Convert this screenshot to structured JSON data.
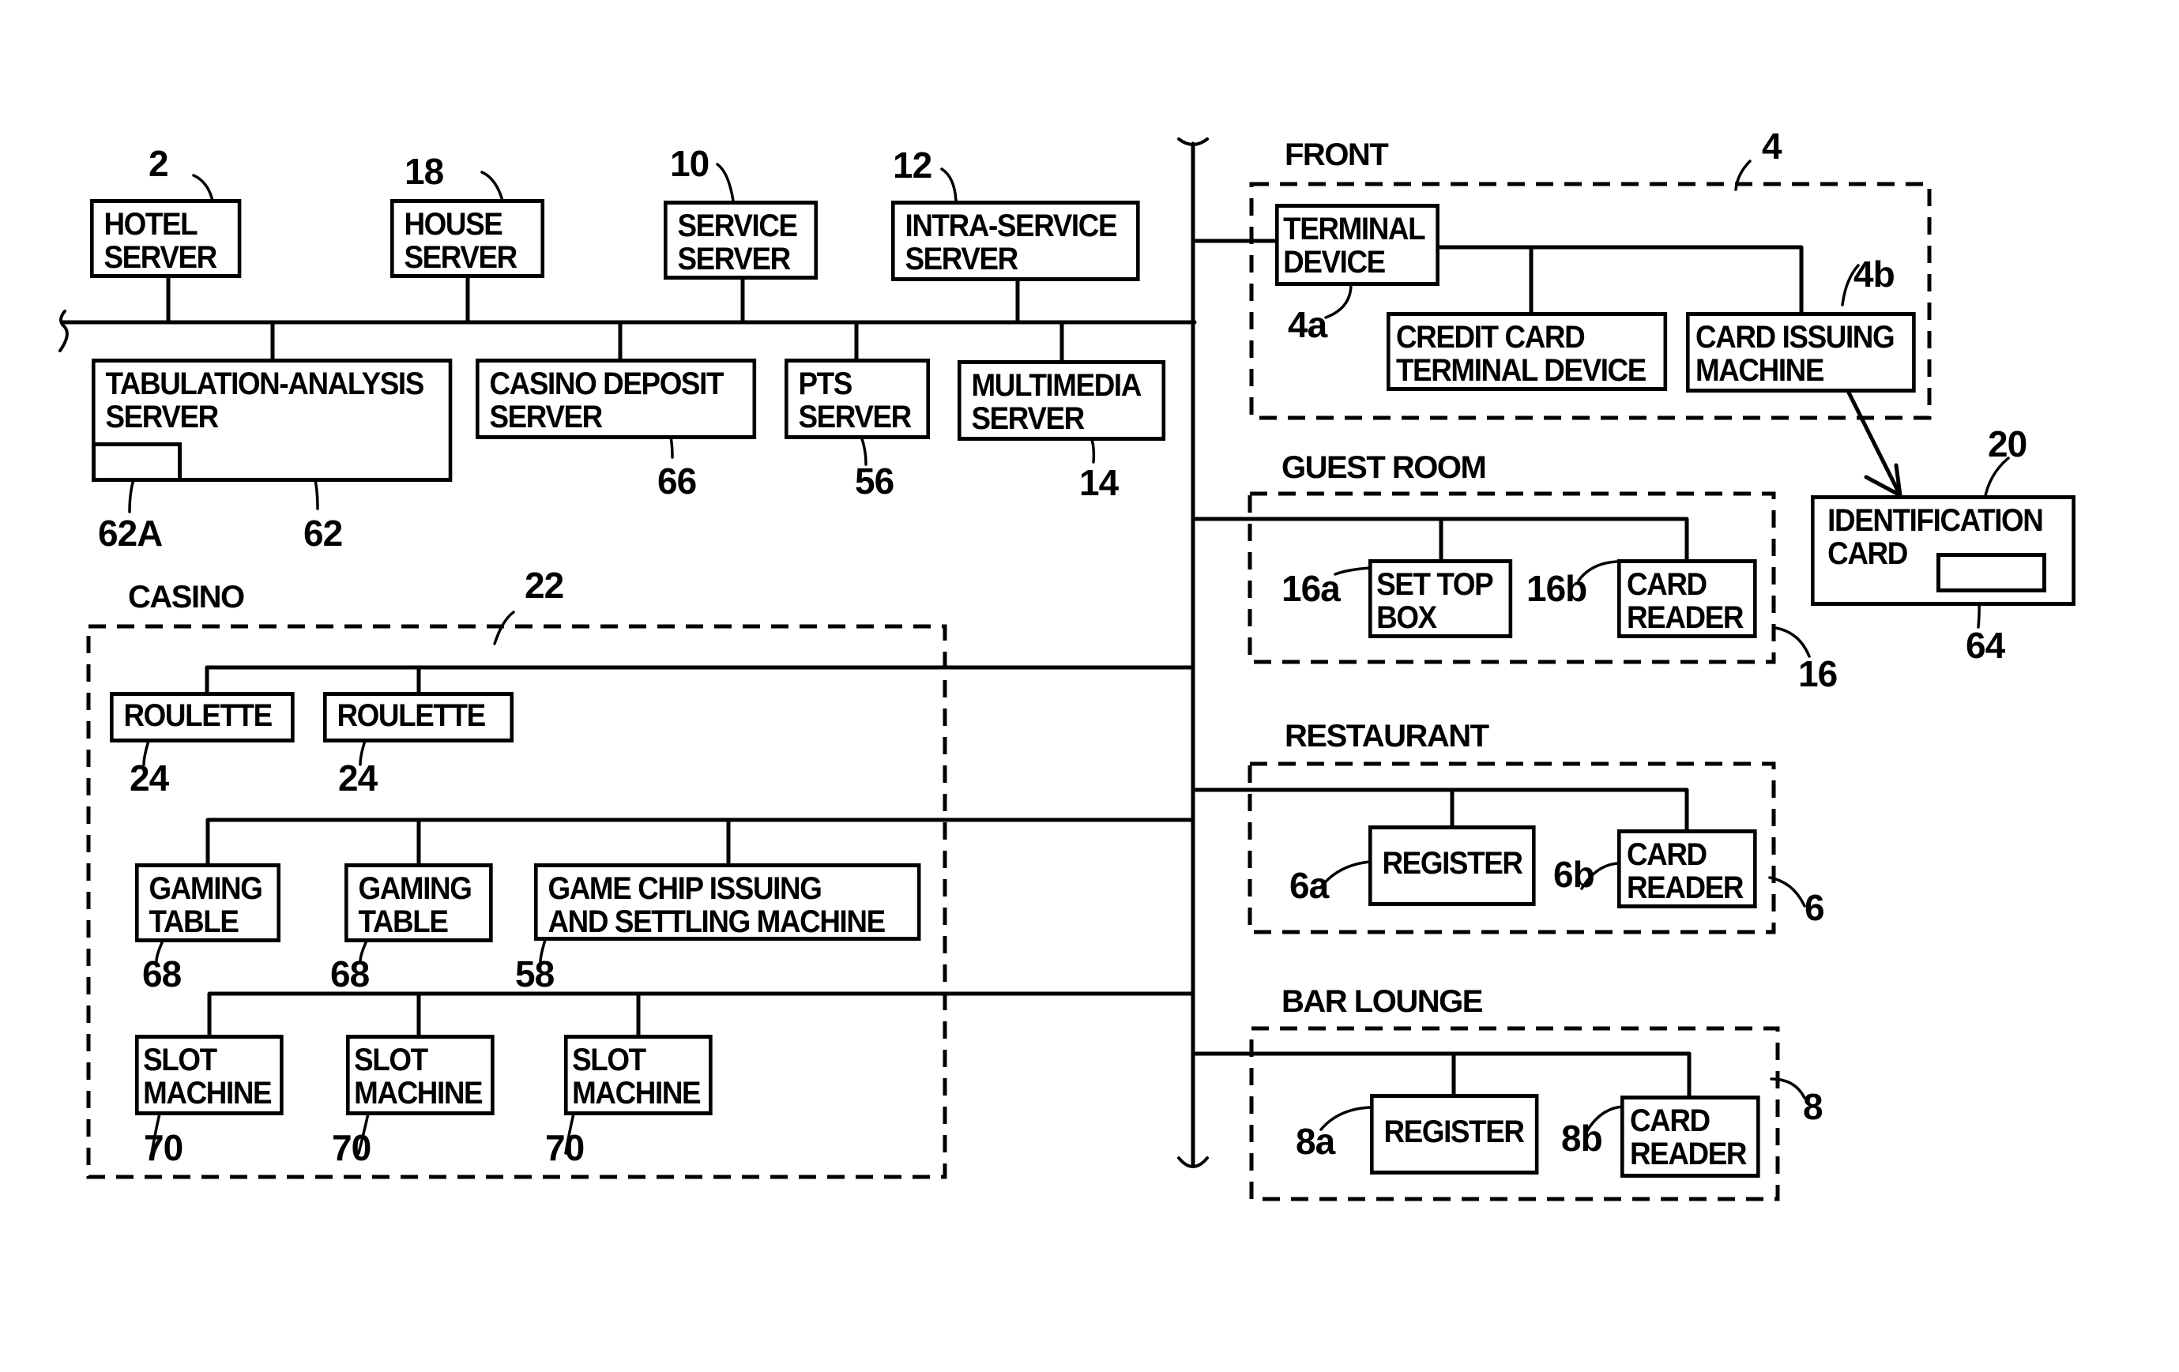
{
  "figure": {
    "bus": {
      "top_network": "hotel-lan",
      "trunk": "vertical-trunk"
    },
    "servers": [
      {
        "id": "hotel-server",
        "label_lines": [
          "HOTEL",
          "SERVER"
        ],
        "ref": "2"
      },
      {
        "id": "house-server",
        "label_lines": [
          "HOUSE",
          "SERVER"
        ],
        "ref": "18"
      },
      {
        "id": "service-server",
        "label_lines": [
          "SERVICE",
          "SERVER"
        ],
        "ref": "10"
      },
      {
        "id": "intra-service-server",
        "label_lines": [
          "INTRA-SERVICE",
          "SERVER"
        ],
        "ref": "12"
      },
      {
        "id": "tabulation-analysis-server",
        "label_lines": [
          "TABULATION-ANALYSIS",
          "SERVER"
        ],
        "ref": "62",
        "sub_ref": "62A"
      },
      {
        "id": "casino-deposit-server",
        "label_lines": [
          "CASINO DEPOSIT",
          "SERVER"
        ],
        "ref": "66"
      },
      {
        "id": "pts-server",
        "label_lines": [
          "PTS",
          "SERVER"
        ],
        "ref": "56"
      },
      {
        "id": "multimedia-server",
        "label_lines": [
          "MULTIMEDIA",
          "SERVER"
        ],
        "ref": "14"
      }
    ],
    "regions": {
      "front": {
        "title": "FRONT",
        "ref": "4",
        "devices": [
          {
            "id": "terminal-device",
            "label_lines": [
              "TERMINAL",
              "DEVICE"
            ],
            "ref": "4a"
          },
          {
            "id": "credit-card-terminal",
            "label_lines": [
              "CREDIT CARD",
              "TERMINAL DEVICE"
            ]
          },
          {
            "id": "card-issuing-machine",
            "label_lines": [
              "CARD ISSUING",
              "MACHINE"
            ],
            "ref": "4b"
          }
        ]
      },
      "guest_room": {
        "title": "GUEST ROOM",
        "ref": "16",
        "devices": [
          {
            "id": "set-top-box",
            "label_lines": [
              "SET TOP",
              "BOX"
            ],
            "ref": "16a"
          },
          {
            "id": "card-reader",
            "label_lines": [
              "CARD",
              "READER"
            ],
            "ref": "16b"
          }
        ]
      },
      "restaurant": {
        "title": "RESTAURANT",
        "ref": "6",
        "devices": [
          {
            "id": "register",
            "label_lines": [
              "REGISTER"
            ],
            "ref": "6a"
          },
          {
            "id": "card-reader",
            "label_lines": [
              "CARD",
              "READER"
            ],
            "ref": "6b"
          }
        ]
      },
      "bar_lounge": {
        "title": "BAR LOUNGE",
        "ref": "8",
        "devices": [
          {
            "id": "register",
            "label_lines": [
              "REGISTER"
            ],
            "ref": "8a"
          },
          {
            "id": "card-reader",
            "label_lines": [
              "CARD",
              "READER"
            ],
            "ref": "8b"
          }
        ]
      },
      "casino": {
        "title": "CASINO",
        "ref": "22",
        "roulettes": [
          {
            "label_lines": [
              "ROULETTE"
            ],
            "ref": "24"
          },
          {
            "label_lines": [
              "ROULETTE"
            ],
            "ref": "24"
          }
        ],
        "tables": [
          {
            "label_lines": [
              "GAMING",
              "TABLE"
            ],
            "ref": "68"
          },
          {
            "label_lines": [
              "GAMING",
              "TABLE"
            ],
            "ref": "68"
          },
          {
            "label_lines": [
              "GAME CHIP ISSUING",
              "AND SETTLING MACHINE"
            ],
            "ref": "58"
          }
        ],
        "slots": [
          {
            "label_lines": [
              "SLOT",
              "MACHINE"
            ],
            "ref": "70"
          },
          {
            "label_lines": [
              "SLOT",
              "MACHINE"
            ],
            "ref": "70"
          },
          {
            "label_lines": [
              "SLOT",
              "MACHINE"
            ],
            "ref": "70"
          }
        ]
      }
    },
    "identification_card": {
      "label_lines": [
        "IDENTIFICATION",
        "CARD"
      ],
      "ref": "20",
      "chip_ref": "64"
    }
  }
}
